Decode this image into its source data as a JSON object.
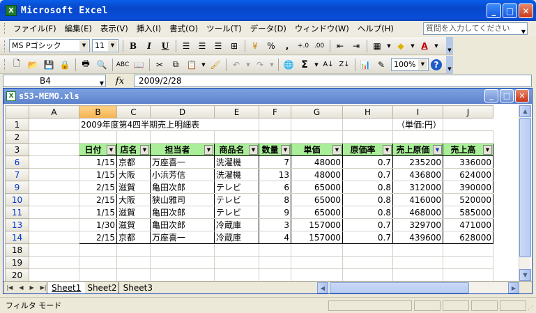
{
  "window": {
    "title": "Microsoft Excel",
    "minimize": "_",
    "maximize": "□",
    "close": "✕"
  },
  "menu": {
    "items": [
      "ファイル(F)",
      "編集(E)",
      "表示(V)",
      "挿入(I)",
      "書式(O)",
      "ツール(T)",
      "データ(D)",
      "ウィンドウ(W)",
      "ヘルプ(H)"
    ],
    "help_placeholder": "質問を入力してください"
  },
  "toolbar": {
    "font_name": "MS Pゴシック",
    "font_size": "11",
    "bold": "B",
    "italic": "I",
    "underline": "U",
    "percent": "%",
    "comma": ",",
    "inc_decimal": "+.0",
    "dec_decimal": ".00",
    "zoom": "100%"
  },
  "formula_bar": {
    "name_box": "B4",
    "fx": "fx",
    "value": "2009/2/28"
  },
  "workbook": {
    "title": "s53-MEMO.xls"
  },
  "sheet": {
    "columns": [
      "A",
      "B",
      "C",
      "D",
      "E",
      "F",
      "G",
      "H",
      "I",
      "J"
    ],
    "selected_column": "B",
    "title_row": {
      "row": "1",
      "title": "2009年度第4四半期売上明細表",
      "unit": "（単価:円）"
    },
    "empty_rows_top": [
      "2"
    ],
    "header_row": {
      "row": "3",
      "headers": [
        "日付",
        "店名",
        "担当者",
        "商品名",
        "数量",
        "単価",
        "原価率",
        "売上原価",
        "売上高"
      ]
    },
    "data_rows": [
      {
        "row": "6",
        "cells": [
          "1/15",
          "京都",
          "万座喜一",
          "洗濯機",
          "7",
          "48000",
          "0.7",
          "235200",
          "336000"
        ]
      },
      {
        "row": "7",
        "cells": [
          "1/15",
          "大阪",
          "小浜芳信",
          "洗濯機",
          "13",
          "48000",
          "0.7",
          "436800",
          "624000"
        ]
      },
      {
        "row": "9",
        "cells": [
          "2/15",
          "滋賀",
          "亀田次郎",
          "テレビ",
          "6",
          "65000",
          "0.8",
          "312000",
          "390000"
        ]
      },
      {
        "row": "10",
        "cells": [
          "2/15",
          "大阪",
          "狭山雅司",
          "テレビ",
          "8",
          "65000",
          "0.8",
          "416000",
          "520000"
        ]
      },
      {
        "row": "11",
        "cells": [
          "1/15",
          "滋賀",
          "亀田次郎",
          "テレビ",
          "9",
          "65000",
          "0.8",
          "468000",
          "585000"
        ]
      },
      {
        "row": "13",
        "cells": [
          "1/30",
          "滋賀",
          "亀田次郎",
          "冷蔵庫",
          "3",
          "157000",
          "0.7",
          "329700",
          "471000"
        ]
      },
      {
        "row": "14",
        "cells": [
          "2/15",
          "京都",
          "万座喜一",
          "冷蔵庫",
          "4",
          "157000",
          "0.7",
          "439600",
          "628000"
        ]
      }
    ],
    "empty_rows_bottom": [
      "18",
      "19",
      "20"
    ]
  },
  "tabs": {
    "nav": [
      "|◀",
      "◀",
      "▶",
      "▶|"
    ],
    "sheets": [
      "Sheet1",
      "Sheet2",
      "Sheet3"
    ],
    "active": "Sheet1"
  },
  "status": {
    "text": "フィルタ モード"
  }
}
